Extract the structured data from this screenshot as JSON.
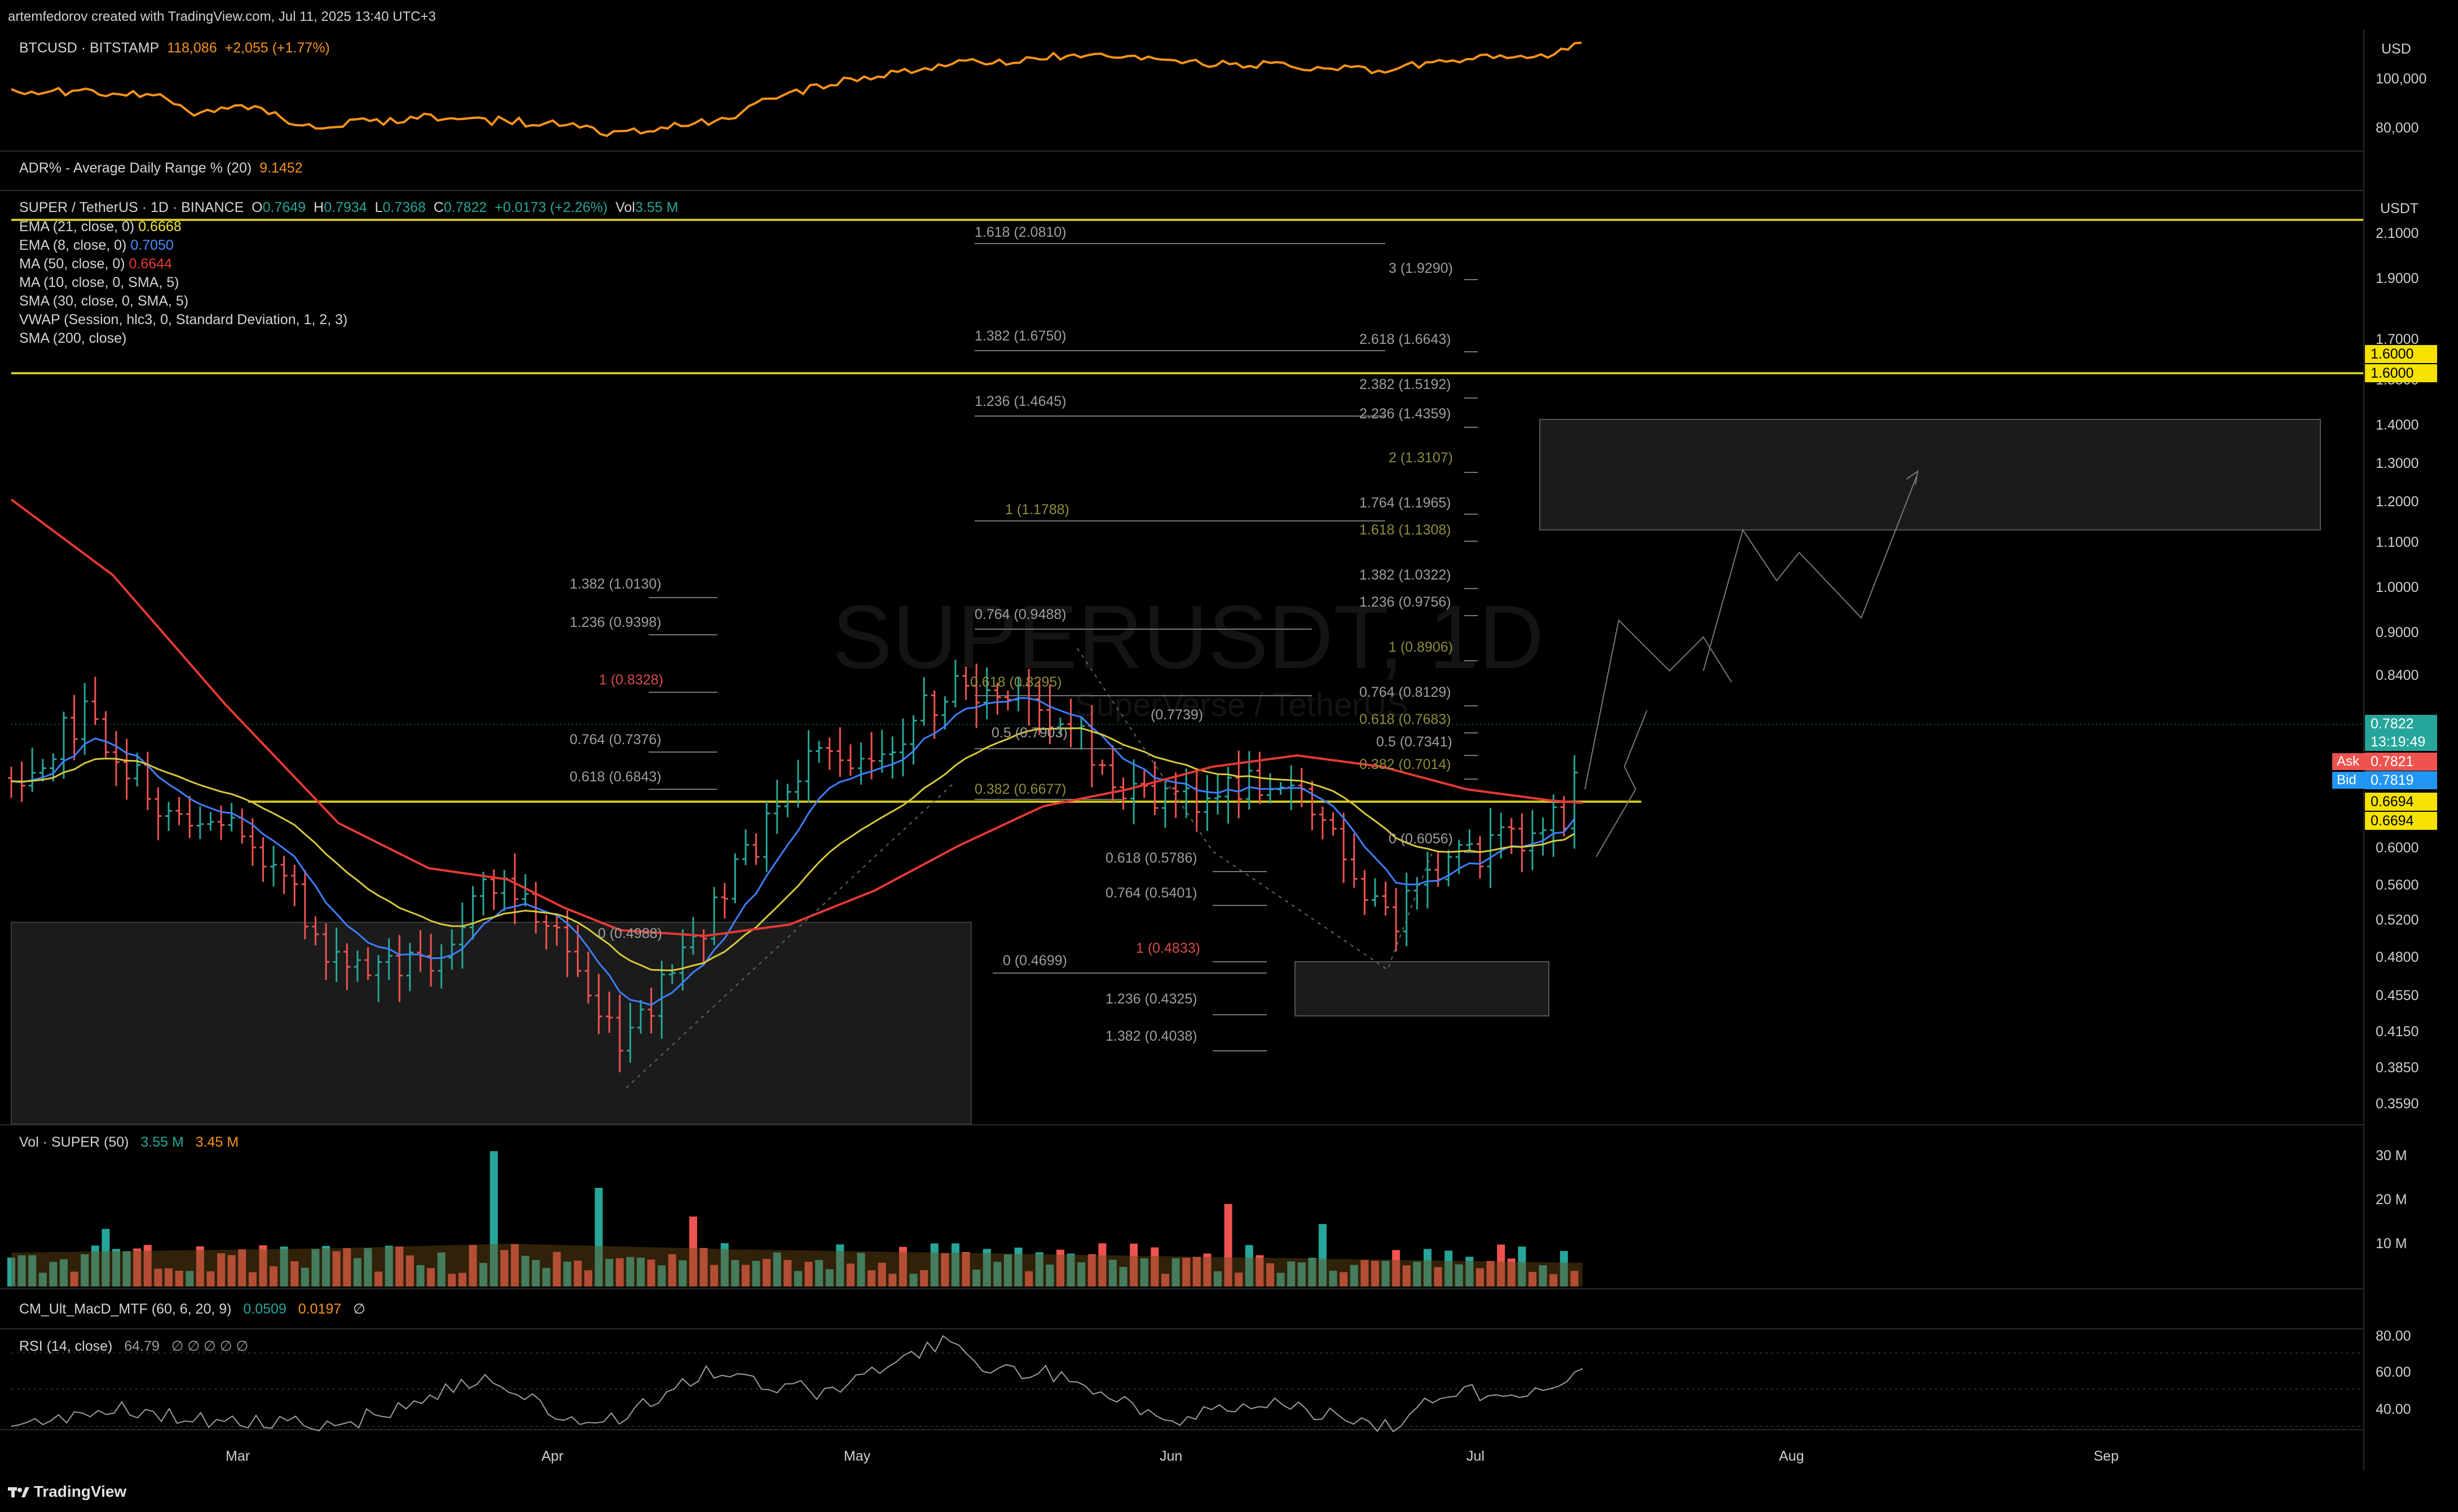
{
  "header": {
    "created_by": "artemfedorov created with TradingView.com, Jul 11, 2025 13:40 UTC+3"
  },
  "btc_panel": {
    "symbol": "BTCUSD · BITSTAMP",
    "price": "118,086",
    "change": "+2,055 (+1.77%)",
    "currency": "USD",
    "axis_labels": [
      "100,000",
      "80,000"
    ],
    "line_color": "#f7931a"
  },
  "adr_panel": {
    "label": "ADR% - Average Daily Range % (20)",
    "value": "9.1452"
  },
  "main_panel": {
    "symbol": "SUPER / TetherUS · 1D · BINANCE",
    "o_label": "O",
    "o": "0.7649",
    "h_label": "H",
    "h": "0.7934",
    "l_label": "L",
    "l": "0.7368",
    "c_label": "C",
    "c": "0.7822",
    "change": "+0.0173 (+2.26%)",
    "vol_label": "Vol",
    "vol": "3.55 M",
    "currency": "USDT",
    "watermark_symbol": "SUPERUSDT, 1D",
    "watermark_name": "SuperVerse / TetherUS",
    "indicators": [
      {
        "label": "EMA (21, close, 0)",
        "value": "0.6668",
        "color": "#f0e442"
      },
      {
        "label": "EMA (8, close, 0)",
        "value": "0.7050",
        "color": "#4a8cff"
      },
      {
        "label": "MA (50, close, 0)",
        "value": "0.6644",
        "color": "#e53935"
      },
      {
        "label": "MA (10, close, 0, SMA, 5)",
        "value": "",
        "color": "#cfcfcf"
      },
      {
        "label": "SMA (30, close, 0, SMA, 5)",
        "value": "",
        "color": "#cfcfcf"
      },
      {
        "label": "VWAP (Session, hlc3, 0, Standard Deviation, 1, 2, 3)",
        "value": "",
        "color": "#cfcfcf"
      },
      {
        "label": "SMA (200, close)",
        "value": "",
        "color": "#cfcfcf"
      }
    ],
    "price_axis": [
      "2.1000",
      "1.9000",
      "1.7000",
      "1.5500",
      "1.4000",
      "1.3000",
      "1.2000",
      "1.1000",
      "1.0000",
      "0.9000",
      "0.8400",
      "0.7600",
      "0.7000",
      "0.6000",
      "0.5600",
      "0.5200",
      "0.4800",
      "0.4550",
      "0.4150",
      "0.3850",
      "0.3590"
    ],
    "tags": {
      "resistance_1": "1.6000",
      "resistance_2": "1.6000",
      "last_price": "0.7822",
      "countdown": "13:19:49",
      "ask_label": "Ask",
      "ask": "0.7821",
      "bid_label": "Bid",
      "bid": "0.7819",
      "support_1": "0.6694",
      "support_2": "0.6694"
    },
    "fib_labels": {
      "a1": "1.618 (2.0810)",
      "a2": "1.382 (1.6750)",
      "a3": "1.236 (1.4645)",
      "a4": "1 (1.1788)",
      "a5": "0.764 (0.9488)",
      "a6": "0.618 (0.8295)",
      "a7": "0.5 (0.7903)",
      "a8": "0.382 (0.6677)",
      "b1": "1.382 (1.0130)",
      "b2": "1.236 (0.9398)",
      "b3": "1 (0.8328)",
      "b4": "0.764 (0.7376)",
      "b5": "0.618 (0.6843)",
      "b6": "0 (0.4988)",
      "c1": "(0.7739)",
      "c2": "0.618 (0.5786)",
      "c3": "0.764 (0.5401)",
      "c4": "1 (0.4833)",
      "c5": "0 (0.4699)",
      "c6": "1.236 (0.4325)",
      "c7": "1.382 (0.4038)",
      "d1": "3 (1.9290)",
      "d2": "2.618 (1.6643)",
      "d3": "2.382 (1.5192)",
      "d4": "2.236 (1.4359)",
      "d5": "2 (1.3107)",
      "d6": "1.764 (1.1965)",
      "d7": "1.618 (1.1308)",
      "d8": "1.382 (1.0322)",
      "d9": "1.236 (0.9756)",
      "d10": "1 (0.8906)",
      "d11": "0.764 (0.8129)",
      "d12": "0.618 (0.7683)",
      "d13": "0.5 (0.7341)",
      "d14": "0.382 (0.7014)",
      "d15": "0 (0.6056)"
    }
  },
  "volume_panel": {
    "label": "Vol · SUPER (50)",
    "value1": "3.55 M",
    "value2": "3.45 M",
    "axis_labels": [
      "30 M",
      "20 M",
      "10 M"
    ]
  },
  "macd_panel": {
    "label": "CM_Ult_MacD_MTF (60, 6, 20, 9)",
    "value1": "0.0509",
    "value2": "0.0197",
    "value3": "∅"
  },
  "rsi_panel": {
    "label": "RSI (14, close)",
    "value": "64.79",
    "extra": "∅ ∅ ∅ ∅ ∅",
    "axis_labels": [
      "80.00",
      "60.00",
      "40.00"
    ]
  },
  "time_axis": [
    "Mar",
    "Apr",
    "May",
    "Jun",
    "Jul",
    "Aug",
    "Sep"
  ],
  "footer": {
    "brand": "TradingView"
  },
  "chart_data": {
    "type": "candlestick",
    "title": "SUPER / TetherUS · 1D · BINANCE",
    "timeframe": "1D",
    "y_scale": "log",
    "ylim": [
      0.359,
      2.1
    ],
    "last": {
      "open": 0.7649,
      "high": 0.7934,
      "low": 0.7368,
      "close": 0.7822
    },
    "approx_closes": {
      "x": [
        "2025-02-15",
        "2025-03-01",
        "2025-03-15",
        "2025-04-01",
        "2025-04-08",
        "2025-04-20",
        "2025-05-01",
        "2025-05-12",
        "2025-05-22",
        "2025-06-01",
        "2025-06-10",
        "2025-06-22",
        "2025-07-01",
        "2025-07-11"
      ],
      "y": [
        0.72,
        0.7,
        0.52,
        0.55,
        0.41,
        0.53,
        0.63,
        0.82,
        0.79,
        0.66,
        0.7,
        0.49,
        0.66,
        0.7822
      ]
    },
    "horizontal_levels": [
      1.6,
      0.6694
    ],
    "zones": [
      {
        "from": 1.16,
        "to": 1.42
      },
      {
        "from": 0.435,
        "to": 0.482
      },
      {
        "from": 0.359,
        "to": 0.52
      }
    ]
  }
}
